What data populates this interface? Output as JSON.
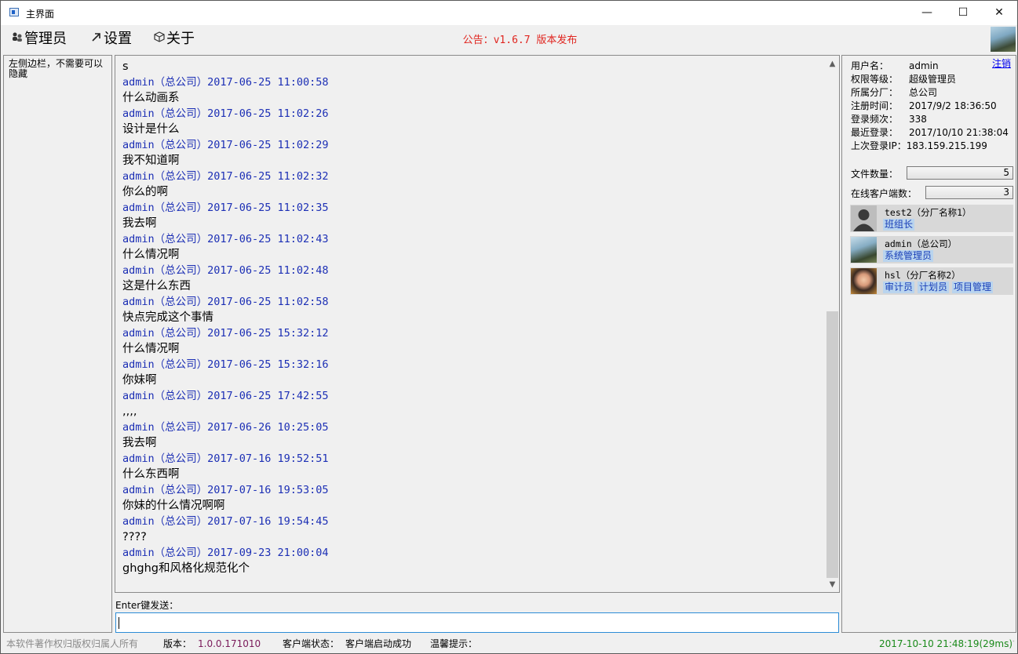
{
  "window": {
    "title": "主界面",
    "minimize": "—",
    "maximize": "☐",
    "close": "✕"
  },
  "menu": {
    "items": [
      {
        "label": "管理员",
        "icon": "users-icon"
      },
      {
        "label": "设置",
        "icon": "arrow-icon"
      },
      {
        "label": "关于",
        "icon": "cube-icon"
      }
    ],
    "notice": "公告：v1.6.7 版本发布"
  },
  "left_panel": {
    "text": "左侧边栏，不需要可以隐藏"
  },
  "chat": {
    "messages": [
      {
        "type": "txt",
        "text": "s"
      },
      {
        "type": "meta",
        "text": "admin（总公司）2017-06-25 11:00:58"
      },
      {
        "type": "txt",
        "text": "什么动画系"
      },
      {
        "type": "meta",
        "text": "admin（总公司）2017-06-25 11:02:26"
      },
      {
        "type": "txt",
        "text": "设计是什么"
      },
      {
        "type": "meta",
        "text": "admin（总公司）2017-06-25 11:02:29"
      },
      {
        "type": "txt",
        "text": "我不知道啊"
      },
      {
        "type": "meta",
        "text": "admin（总公司）2017-06-25 11:02:32"
      },
      {
        "type": "txt",
        "text": "你么的啊"
      },
      {
        "type": "meta",
        "text": "admin（总公司）2017-06-25 11:02:35"
      },
      {
        "type": "txt",
        "text": "我去啊"
      },
      {
        "type": "meta",
        "text": "admin（总公司）2017-06-25 11:02:43"
      },
      {
        "type": "txt",
        "text": "什么情况啊"
      },
      {
        "type": "meta",
        "text": "admin（总公司）2017-06-25 11:02:48"
      },
      {
        "type": "txt",
        "text": "这是什么东西"
      },
      {
        "type": "meta",
        "text": "admin（总公司）2017-06-25 11:02:58"
      },
      {
        "type": "txt",
        "text": "快点完成这个事情"
      },
      {
        "type": "meta",
        "text": "admin（总公司）2017-06-25 15:32:12"
      },
      {
        "type": "txt",
        "text": "什么情况啊"
      },
      {
        "type": "meta",
        "text": "admin（总公司）2017-06-25 15:32:16"
      },
      {
        "type": "txt",
        "text": "你妹啊"
      },
      {
        "type": "meta",
        "text": "admin（总公司）2017-06-25 17:42:55"
      },
      {
        "type": "txt",
        "text": ",,,,"
      },
      {
        "type": "meta",
        "text": "admin（总公司）2017-06-26 10:25:05"
      },
      {
        "type": "txt",
        "text": "我去啊"
      },
      {
        "type": "meta",
        "text": "admin（总公司）2017-07-16 19:52:51"
      },
      {
        "type": "txt",
        "text": "什么东西啊"
      },
      {
        "type": "meta",
        "text": "admin（总公司）2017-07-16 19:53:05"
      },
      {
        "type": "txt",
        "text": "你妹的什么情况啊啊"
      },
      {
        "type": "meta",
        "text": "admin（总公司）2017-07-16 19:54:45"
      },
      {
        "type": "txt",
        "text": "????"
      },
      {
        "type": "meta",
        "text": "admin（总公司）2017-09-23 21:00:04"
      },
      {
        "type": "txt",
        "text": "ghghg和风格化规范化个"
      }
    ]
  },
  "input": {
    "label": "Enter键发送：",
    "value": ""
  },
  "right_panel": {
    "logout": "注销",
    "info": [
      {
        "key": "用户名：",
        "value": "admin"
      },
      {
        "key": "权限等级：",
        "value": "超级管理员"
      },
      {
        "key": "所属分厂：",
        "value": "总公司"
      },
      {
        "key": "注册时间：",
        "value": "2017/9/2 18:36:50"
      },
      {
        "key": "登录频次：",
        "value": "338"
      },
      {
        "key": "最近登录：",
        "value": "2017/10/10 21:38:04"
      },
      {
        "key": "上次登录IP：",
        "value": "183.159.215.199"
      }
    ],
    "file_count_label": "文件数量：",
    "file_count": "5",
    "online_label": "在线客户端数：",
    "online_count": "3",
    "users": [
      {
        "name": "test2（分厂名称1）",
        "roles": [
          "班组长"
        ],
        "avatar": "default-avatar"
      },
      {
        "name": "admin（总公司）",
        "roles": [
          "系统管理员"
        ],
        "avatar": "photo-avatar"
      },
      {
        "name": "hsl（分厂名称2）",
        "roles": [
          "审计员",
          "计划员",
          "项目管理"
        ],
        "avatar": "photo-avatar"
      }
    ]
  },
  "status_bar": {
    "copyright": "本软件著作权归版权归属人所有",
    "version_label": "版本：",
    "version": "1.0.0.171010",
    "client_state_label": "客户端状态：",
    "client_state": "客户端启动成功",
    "tip_label": "温馨提示：",
    "time": "2017-10-10 21:48:19(29ms)"
  }
}
